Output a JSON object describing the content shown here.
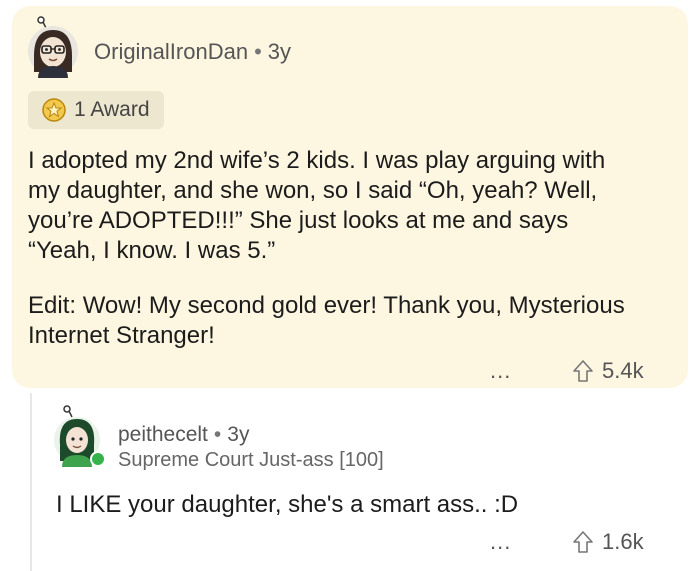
{
  "comment": {
    "username": "OriginalIronDan",
    "age": "3y",
    "award_label": "1 Award",
    "paragraph1_lines": [
      "I adopted my 2nd wife’s 2 kids. I was play arguing with",
      "my daughter, and she won, so I said “Oh, yeah? Well,",
      "you’re ADOPTED!!!” She just looks at me and says",
      "“Yeah, I know. I was 5.”"
    ],
    "paragraph2_lines": [
      "Edit: Wow! My second gold ever! Thank you, Mysterious",
      "Internet Stranger!"
    ],
    "more": "...",
    "votes": "5.4k"
  },
  "reply": {
    "username": "peithecelt",
    "age": "3y",
    "flair": "Supreme Court Just-ass [100]",
    "text": "I LIKE your daughter, she's a smart ass.. :D",
    "more": "...",
    "votes": "1.6k"
  },
  "colors": {
    "card_bg": "#fdf7e1",
    "award_bg": "#eee7cf",
    "online": "#35b34a",
    "meta_text": "#555555"
  },
  "icons": [
    "user-avatar-icon",
    "award-star-icon",
    "more-options-icon",
    "upvote-arrow-icon",
    "online-status-icon"
  ]
}
